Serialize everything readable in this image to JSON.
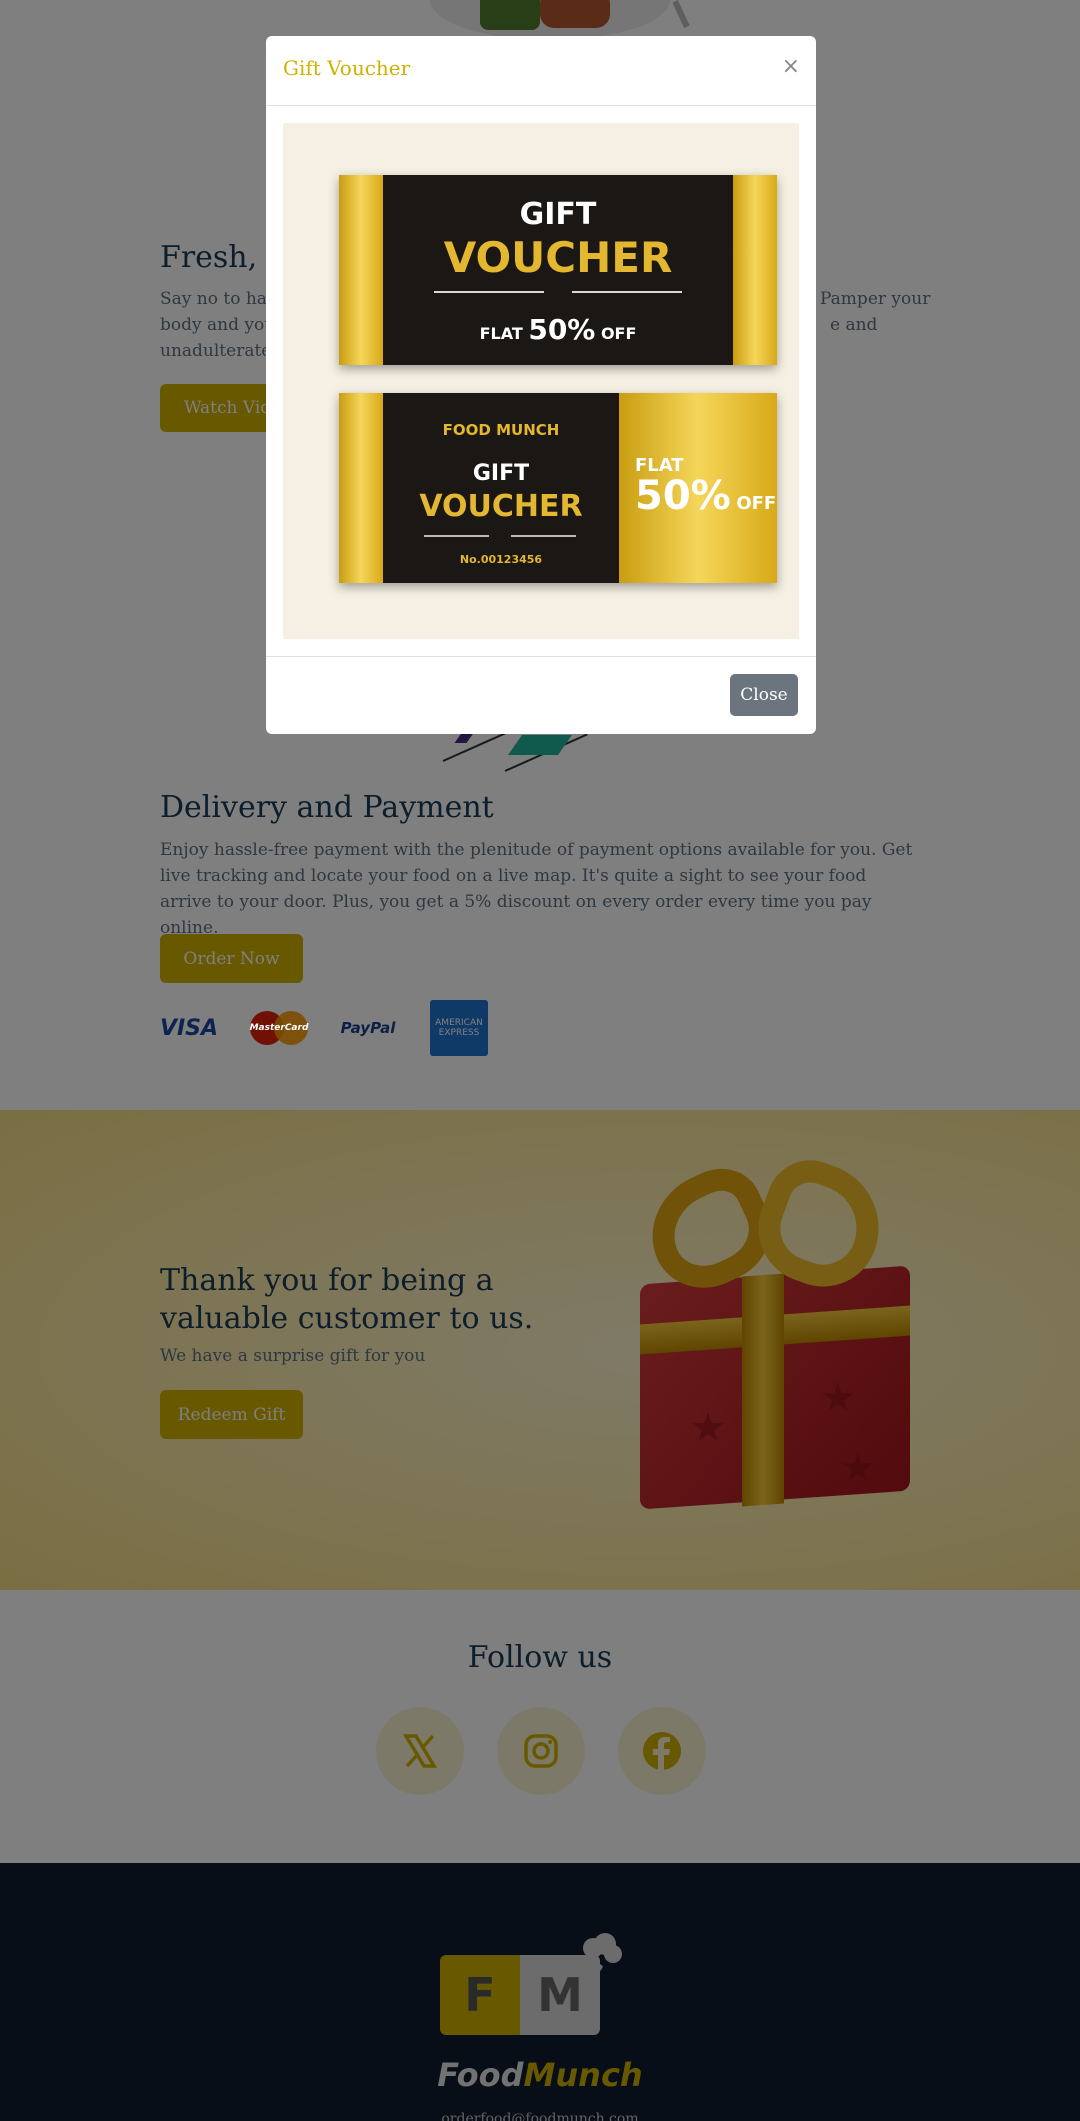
{
  "section_fresh": {
    "title": "Fresh, H",
    "text_line1": "Say no to harm",
    "text_line1_right": "Pamper your",
    "text_line2": "body and your",
    "text_line2_right": "e and",
    "text_line3": "unadulterated",
    "button": "Watch Vide"
  },
  "section_delivery": {
    "title": "Delivery and Payment",
    "text": "Enjoy hassle-free payment with the plenitude of payment options available for you. Get live tracking and locate your food on a live map. It's quite a sight to see your food arrive to your door. Plus, you get a 5% discount on every order every time you pay online.",
    "button": "Order Now",
    "payment_logos": {
      "visa": "VISA",
      "mastercard": "MasterCard",
      "paypal": "PayPal",
      "amex_line1": "AMERICAN",
      "amex_line2": "EXPRESS"
    }
  },
  "section_gift": {
    "title": "Thank you for being a valuable customer to us.",
    "text": "We have a surprise gift for you",
    "button": "Redeem Gift"
  },
  "section_follow": {
    "title": "Follow us",
    "icons": [
      "x-icon",
      "instagram-icon",
      "facebook-icon"
    ]
  },
  "footer": {
    "logo_f": "F",
    "logo_m": "M",
    "brand_part1": "Food",
    "brand_part2": "Munch",
    "email": "orderfood@foodmunch.com"
  },
  "modal": {
    "title": "Gift Voucher",
    "close_symbol": "×",
    "close_button": "Close",
    "voucher1": {
      "gift": "GIFT",
      "voucher": "VOUCHER",
      "flat": "FLAT",
      "percent": "50%",
      "off": "OFF"
    },
    "voucher2": {
      "brand": "FOOD MUNCH",
      "gift": "GIFT",
      "voucher": "VOUCHER",
      "number": "No.00123456",
      "flat": "FLAT",
      "percent": "50%",
      "off": "OFF"
    }
  },
  "colors": {
    "accent_gold": "#d0b200",
    "heading_navy": "#183b56",
    "text_gray": "#5a7184",
    "footer_bg": "#0f1c2e",
    "close_gray": "#6c757d"
  }
}
